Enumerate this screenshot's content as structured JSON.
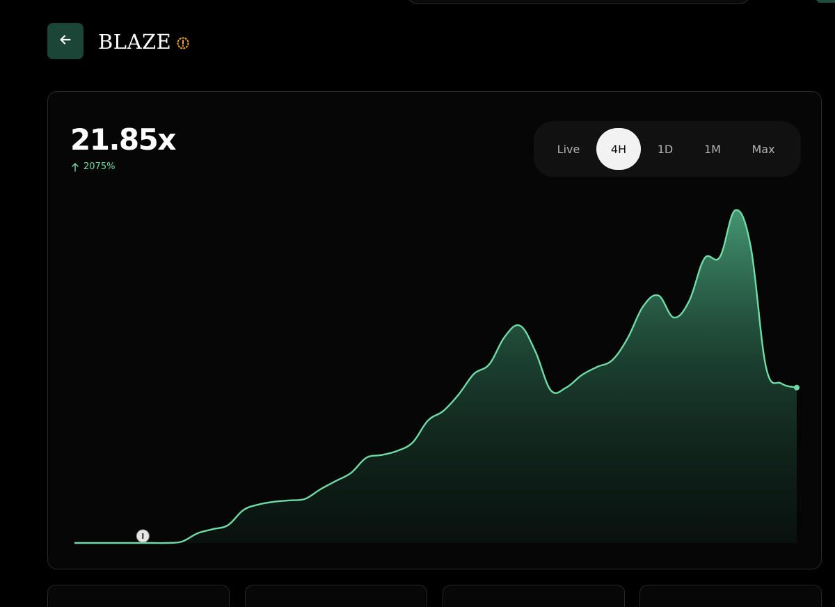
{
  "token": {
    "name": "BLAZE",
    "warning_icon": "warning-circle-icon",
    "back_icon": "arrow-left-icon"
  },
  "stats": {
    "multiplier": "21.85x",
    "change": "2075%",
    "change_icon": "arrow-up-icon"
  },
  "range_tabs": [
    {
      "label": "Live",
      "active": false
    },
    {
      "label": "4H",
      "active": true
    },
    {
      "label": "1D",
      "active": false
    },
    {
      "label": "1M",
      "active": false
    },
    {
      "label": "Max",
      "active": false
    }
  ],
  "colors": {
    "accent": "#6fdba6",
    "back_button": "#1b4536",
    "warning": "#f5a623"
  },
  "chart_data": {
    "type": "area",
    "series": [
      {
        "values": [
          1.0,
          1.0,
          1.0,
          1.0,
          1.0,
          1.0,
          1.0,
          1.1,
          1.7,
          2.0,
          2.3,
          3.4,
          3.8,
          4.0,
          4.1,
          4.2,
          4.9,
          5.5,
          6.1,
          7.2,
          7.4,
          7.7,
          8.3,
          9.9,
          10.6,
          11.8,
          13.3,
          14.0,
          16.0,
          16.8,
          14.9,
          12.1,
          12.3,
          13.2,
          13.8,
          14.3,
          15.9,
          18.2,
          19.0,
          17.4,
          18.6,
          21.7,
          21.8,
          25.2,
          22.6,
          13.8,
          12.6,
          12.3
        ]
      }
    ],
    "markers": [
      {
        "index": 4,
        "label": "I"
      }
    ]
  }
}
